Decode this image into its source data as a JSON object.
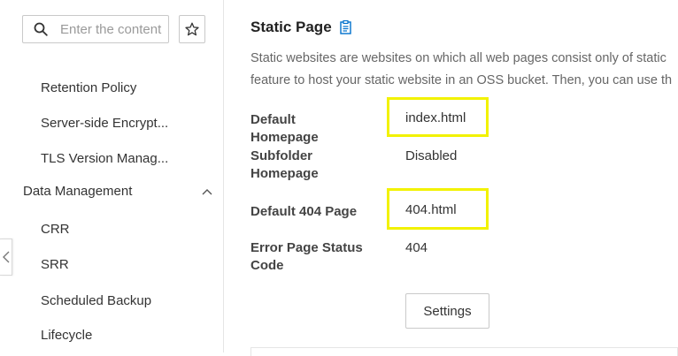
{
  "sidebar": {
    "search_placeholder": "Enter the content",
    "items": [
      {
        "label": "Retention Policy"
      },
      {
        "label": "Server-side Encrypt..."
      },
      {
        "label": "TLS Version Manag..."
      }
    ],
    "group": {
      "label": "Data Management",
      "expanded": true,
      "items": [
        {
          "label": "CRR"
        },
        {
          "label": "SRR"
        },
        {
          "label": "Scheduled Backup"
        },
        {
          "label": "Lifecycle"
        }
      ]
    }
  },
  "main": {
    "title": "Static Page",
    "description_line1": "Static websites are websites on which all web pages consist only of static",
    "description_line2": "feature to host your static website in an OSS bucket. Then, you can use th",
    "fields": [
      {
        "label": "Default Homepage",
        "value": "index.html",
        "highlighted": true
      },
      {
        "label": "Subfolder Homepage",
        "value": "Disabled",
        "highlighted": false
      },
      {
        "label": "Default 404 Page",
        "value": "404.html",
        "highlighted": true
      },
      {
        "label": "Error Page Status Code",
        "value": "404",
        "highlighted": false
      }
    ],
    "settings_label": "Settings"
  },
  "colors": {
    "highlight": "#f2f200",
    "accent": "#0070cc",
    "border": "#c9c9c9"
  },
  "icons": [
    "search-icon",
    "star-icon",
    "chevron-up-icon",
    "chevron-left-icon",
    "document-icon"
  ]
}
